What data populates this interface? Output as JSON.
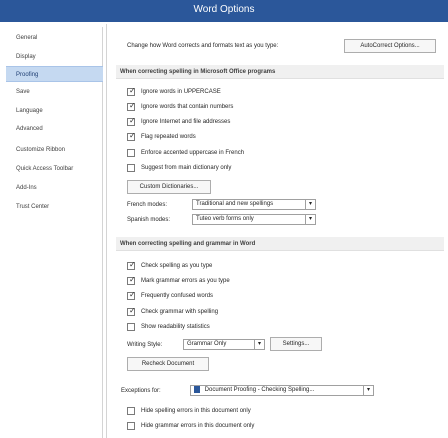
{
  "window": {
    "title": "Word Options"
  },
  "sidebar": {
    "items": [
      {
        "label": "General",
        "selected": false
      },
      {
        "label": "Display",
        "selected": false
      },
      {
        "label": "Proofing",
        "selected": true
      },
      {
        "label": "Save",
        "selected": false
      },
      {
        "label": "Language",
        "selected": false
      },
      {
        "label": "Advanced",
        "selected": false
      },
      {
        "label": "Customize Ribbon",
        "selected": false
      },
      {
        "label": "Quick Access Toolbar",
        "selected": false
      },
      {
        "label": "Add-Ins",
        "selected": false
      },
      {
        "label": "Trust Center",
        "selected": false
      }
    ]
  },
  "autocorrect": {
    "prompt": "Change how Word corrects and formats text as you type:",
    "button": "AutoCorrect Options..."
  },
  "office_section": {
    "header": "When correcting spelling in Microsoft Office programs",
    "options": [
      {
        "label": "Ignore words in UPPERCASE",
        "checked": true
      },
      {
        "label": "Ignore words that contain numbers",
        "checked": true
      },
      {
        "label": "Ignore Internet and file addresses",
        "checked": true
      },
      {
        "label": "Flag repeated words",
        "checked": true
      },
      {
        "label": "Enforce accented uppercase in French",
        "checked": false
      },
      {
        "label": "Suggest from main dictionary only",
        "checked": false
      }
    ],
    "custom_dictionaries_button": "Custom Dictionaries...",
    "french_modes": {
      "label": "French modes:",
      "value": "Traditional and new spellings"
    },
    "spanish_modes": {
      "label": "Spanish modes:",
      "value": "Tuteo verb forms only"
    }
  },
  "word_section": {
    "header": "When correcting spelling and grammar in Word",
    "options": [
      {
        "label": "Check spelling as you type",
        "checked": true
      },
      {
        "label": "Mark grammar errors as you type",
        "checked": true
      },
      {
        "label": "Frequently confused words",
        "checked": true
      },
      {
        "label": "Check grammar with spelling",
        "checked": true
      },
      {
        "label": "Show readability statistics",
        "checked": false
      }
    ],
    "writing_style": {
      "label": "Writing Style:",
      "value": "Grammar Only"
    },
    "settings_button": "Settings...",
    "recheck_button": "Recheck Document"
  },
  "exceptions": {
    "label": "Exceptions for:",
    "document": "Document Proofing - Checking Spelling...",
    "options": [
      {
        "label": "Hide spelling errors in this document only",
        "checked": false
      },
      {
        "label": "Hide grammar errors in this document only",
        "checked": false
      }
    ]
  }
}
